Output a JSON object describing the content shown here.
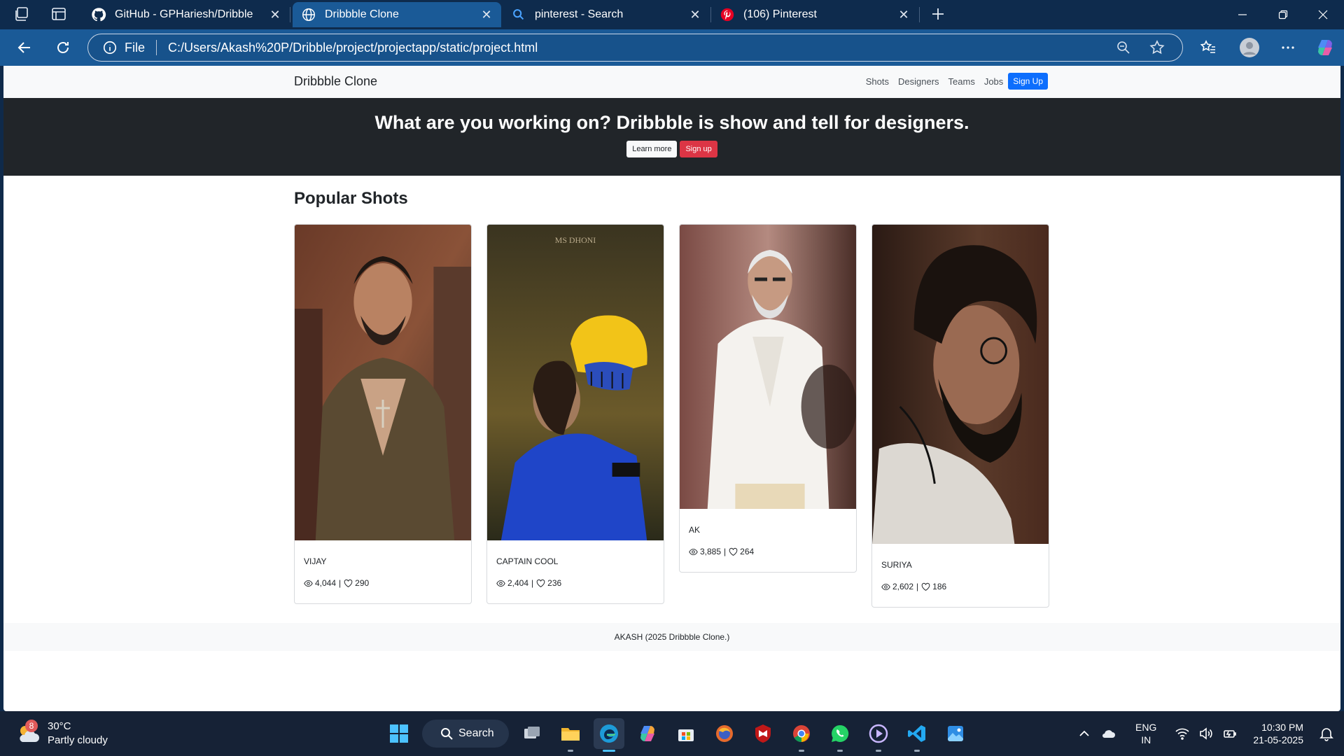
{
  "browser": {
    "tabs": [
      {
        "label": "GitHub - GPHariesh/Dribble",
        "icon": "github-icon",
        "active": false
      },
      {
        "label": "Dribbble Clone",
        "icon": "globe-icon",
        "active": true
      },
      {
        "label": "pinterest - Search",
        "icon": "search-icon",
        "active": false
      },
      {
        "label": "(106) Pinterest",
        "icon": "pinterest-icon",
        "active": false
      }
    ],
    "address": {
      "scheme_label": "File",
      "url": "C:/Users/Akash%20P/Dribble/project/projectapp/static/project.html"
    }
  },
  "site": {
    "brand": "Dribbble Clone",
    "nav": [
      "Shots",
      "Designers",
      "Teams",
      "Jobs"
    ],
    "signup_nav": "Sign Up",
    "hero": {
      "title": "What are you working on? Dribbble is show and tell for designers.",
      "learn_more": "Learn more",
      "sign_up": "Sign up"
    },
    "section_title": "Popular Shots",
    "shots": [
      {
        "name": "VIJAY",
        "views": "4,044",
        "likes": "290",
        "sep": "|"
      },
      {
        "name": "CAPTAIN COOL",
        "views": "2,404",
        "likes": "236",
        "sep": "|",
        "caption": "MS DHONI"
      },
      {
        "name": "AK",
        "views": "3,885",
        "likes": "264",
        "sep": "|"
      },
      {
        "name": "SURIYA",
        "views": "2,602",
        "likes": "186",
        "sep": "|"
      }
    ],
    "footer": "AKASH (2025 Dribbble Clone.)",
    "colors": {
      "primary": "#0d6efd",
      "danger": "#dc3545",
      "hero_bg": "#212529",
      "nav_bg": "#f8f9fa"
    }
  },
  "taskbar": {
    "weather": {
      "badge": "8",
      "temp": "30°C",
      "desc": "Partly cloudy"
    },
    "search_label": "Search",
    "lang": {
      "line1": "ENG",
      "line2": "IN"
    },
    "clock": {
      "time": "10:30 PM",
      "date": "21-05-2025"
    }
  }
}
